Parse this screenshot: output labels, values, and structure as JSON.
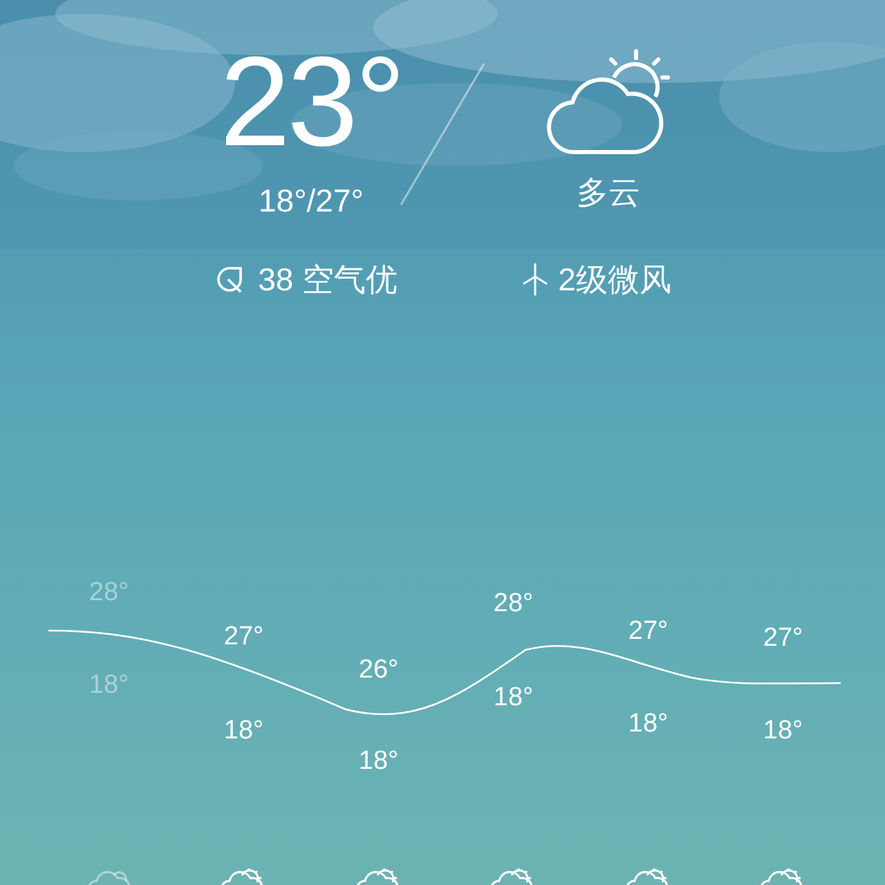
{
  "current": {
    "temperature": "23°",
    "range": "18°/27°",
    "condition": "多云",
    "air_quality": "38 空气优",
    "wind": "2级微风"
  },
  "days": [
    {
      "high": "28°",
      "low": "18°",
      "past": true,
      "kind": "cloudy"
    },
    {
      "high": "27°",
      "low": "18°",
      "past": false,
      "kind": "partly_cloudy"
    },
    {
      "high": "26°",
      "low": "18°",
      "past": false,
      "kind": "partly_cloudy"
    },
    {
      "high": "28°",
      "low": "18°",
      "past": false,
      "kind": "partly_cloudy"
    },
    {
      "high": "27°",
      "low": "18°",
      "past": false,
      "kind": "partly_cloudy"
    },
    {
      "high": "27°",
      "low": "18°",
      "past": false,
      "kind": "partly_cloudy"
    }
  ]
}
